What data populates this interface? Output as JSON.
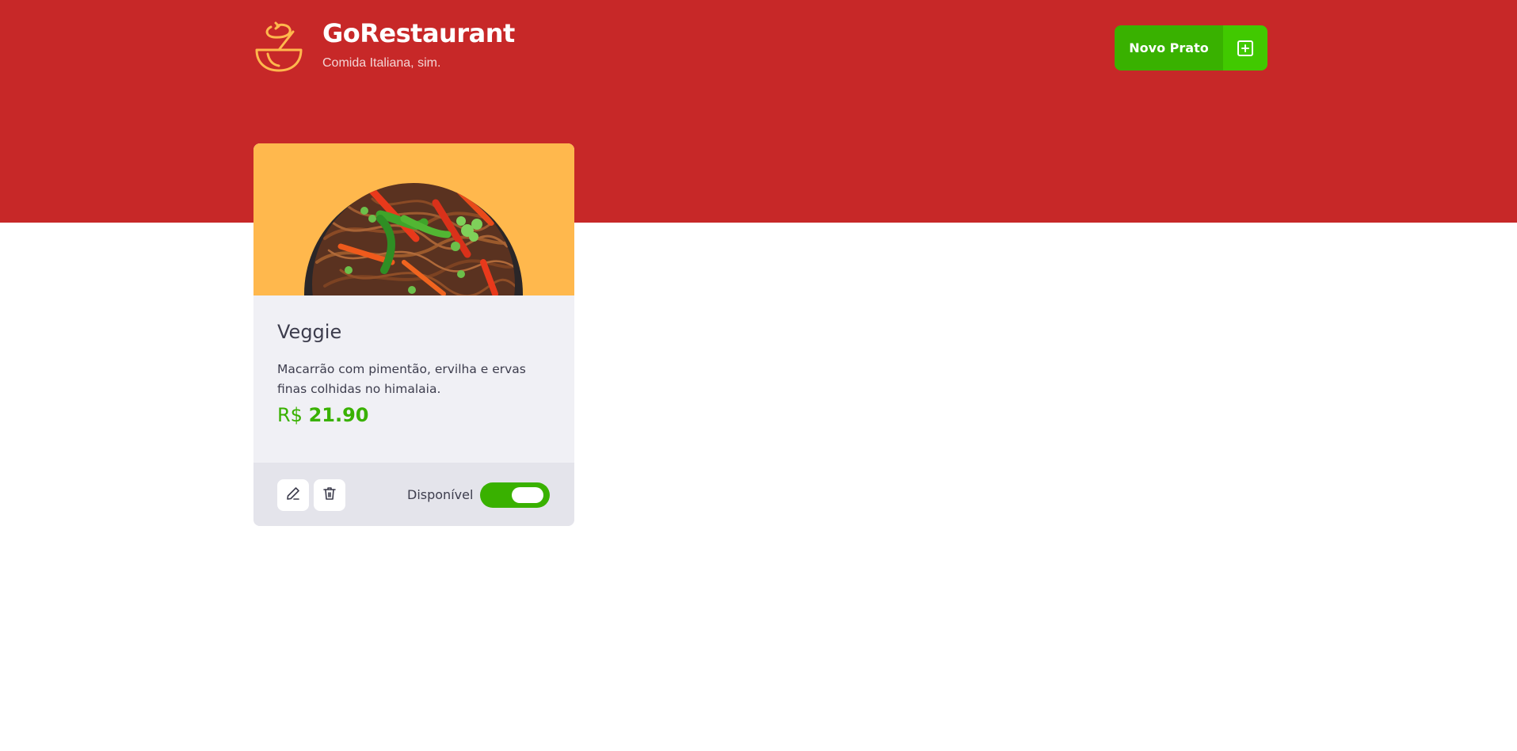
{
  "header": {
    "logo_icon": "bowl-icon",
    "title": "GoRestaurant",
    "subtitle": "Comida Italiana, sim.",
    "new_dish_button": {
      "label": "Novo Prato",
      "icon": "plus-square-icon"
    }
  },
  "colors": {
    "hero_background": "#c72828",
    "accent_green": "#39b100",
    "accent_green_light": "#41c900",
    "card_background": "#f0f0f5",
    "card_footer_background": "#e4e4eb",
    "image_background": "#ffb84d",
    "text_dark": "#3d3d4d"
  },
  "dishes": [
    {
      "name": "Veggie",
      "description": "Macarrão com pimentão, ervilha e ervas finas colhidas no himalaia.",
      "price_currency": "R$",
      "price_value": "21.90",
      "image": "noodles-bowl-image",
      "edit_icon": "pencil-icon",
      "delete_icon": "trash-icon",
      "availability_label": "Disponível",
      "available": true
    }
  ]
}
